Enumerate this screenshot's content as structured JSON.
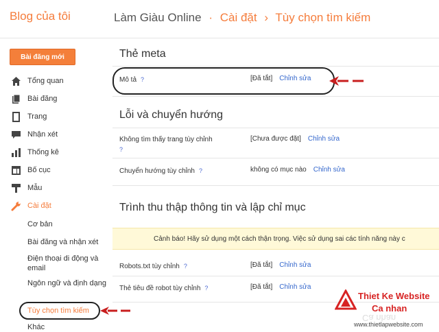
{
  "header": {
    "app_title": "Blog của tôi",
    "blog_name": "Làm Giàu Online",
    "separator": "·",
    "crumb_settings": "Cài đặt",
    "crumb_arrow": "›",
    "crumb_search": "Tùy chọn tìm kiếm"
  },
  "new_post_label": "Bài đăng mới",
  "sidebar": {
    "items": [
      {
        "label": "Tổng quan",
        "icon": "home-icon"
      },
      {
        "label": "Bài đăng",
        "icon": "posts-icon"
      },
      {
        "label": "Trang",
        "icon": "pages-icon"
      },
      {
        "label": "Nhận xét",
        "icon": "comments-icon"
      },
      {
        "label": "Thống kê",
        "icon": "stats-icon"
      },
      {
        "label": "Bố cục",
        "icon": "layout-icon"
      },
      {
        "label": "Mẫu",
        "icon": "template-icon"
      },
      {
        "label": "Cài đặt",
        "icon": "wrench-icon"
      }
    ],
    "sub_items": [
      {
        "label": "Cơ bản"
      },
      {
        "label": "Bài đăng và nhận xét"
      },
      {
        "label": "Điện thoại di động và email"
      },
      {
        "label": "Ngôn ngữ và định dạng"
      },
      {
        "label": "Tùy chọn tìm kiếm"
      },
      {
        "label": "Khác"
      }
    ]
  },
  "main": {
    "meta_section": {
      "title": "Thẻ meta",
      "rows": [
        {
          "label": "Mô tả",
          "help": "?",
          "value": "[Đã tắt]",
          "edit": "Chỉnh sửa"
        }
      ]
    },
    "errors_section": {
      "title": "Lỗi và chuyển hướng",
      "rows": [
        {
          "label": "Không tìm thấy trang tùy chỉnh",
          "help": "?",
          "value": "[Chưa được đặt]",
          "edit": "Chỉnh sửa"
        },
        {
          "label": "Chuyển hướng tùy chỉnh",
          "help": "?",
          "value": "không có mục nào",
          "edit": "Chỉnh sửa"
        }
      ]
    },
    "crawl_section": {
      "title": "Trình thu thập thông tin và lập chỉ mục",
      "warning": "Cảnh báo! Hãy sử dụng một cách thận trọng. Việc sử dụng sai các tính năng này c",
      "rows": [
        {
          "label": "Robots.txt tùy chỉnh",
          "help": "?",
          "value": "[Đã tắt]",
          "edit": "Chỉnh sửa"
        },
        {
          "label": "Thẻ tiêu đề robot tùy chỉnh",
          "help": "?",
          "value": "[Đã tắt]",
          "edit": "Chỉnh sửa"
        }
      ]
    }
  },
  "watermark": {
    "line1": "Thiet Ke Website",
    "line2": "Ca nhan",
    "url": "www.thietlapwebsite.com"
  },
  "colors": {
    "accent": "#f57c3b",
    "link": "#3366cc",
    "warning_bg": "#fff9d8",
    "logo_red": "#d72323"
  }
}
